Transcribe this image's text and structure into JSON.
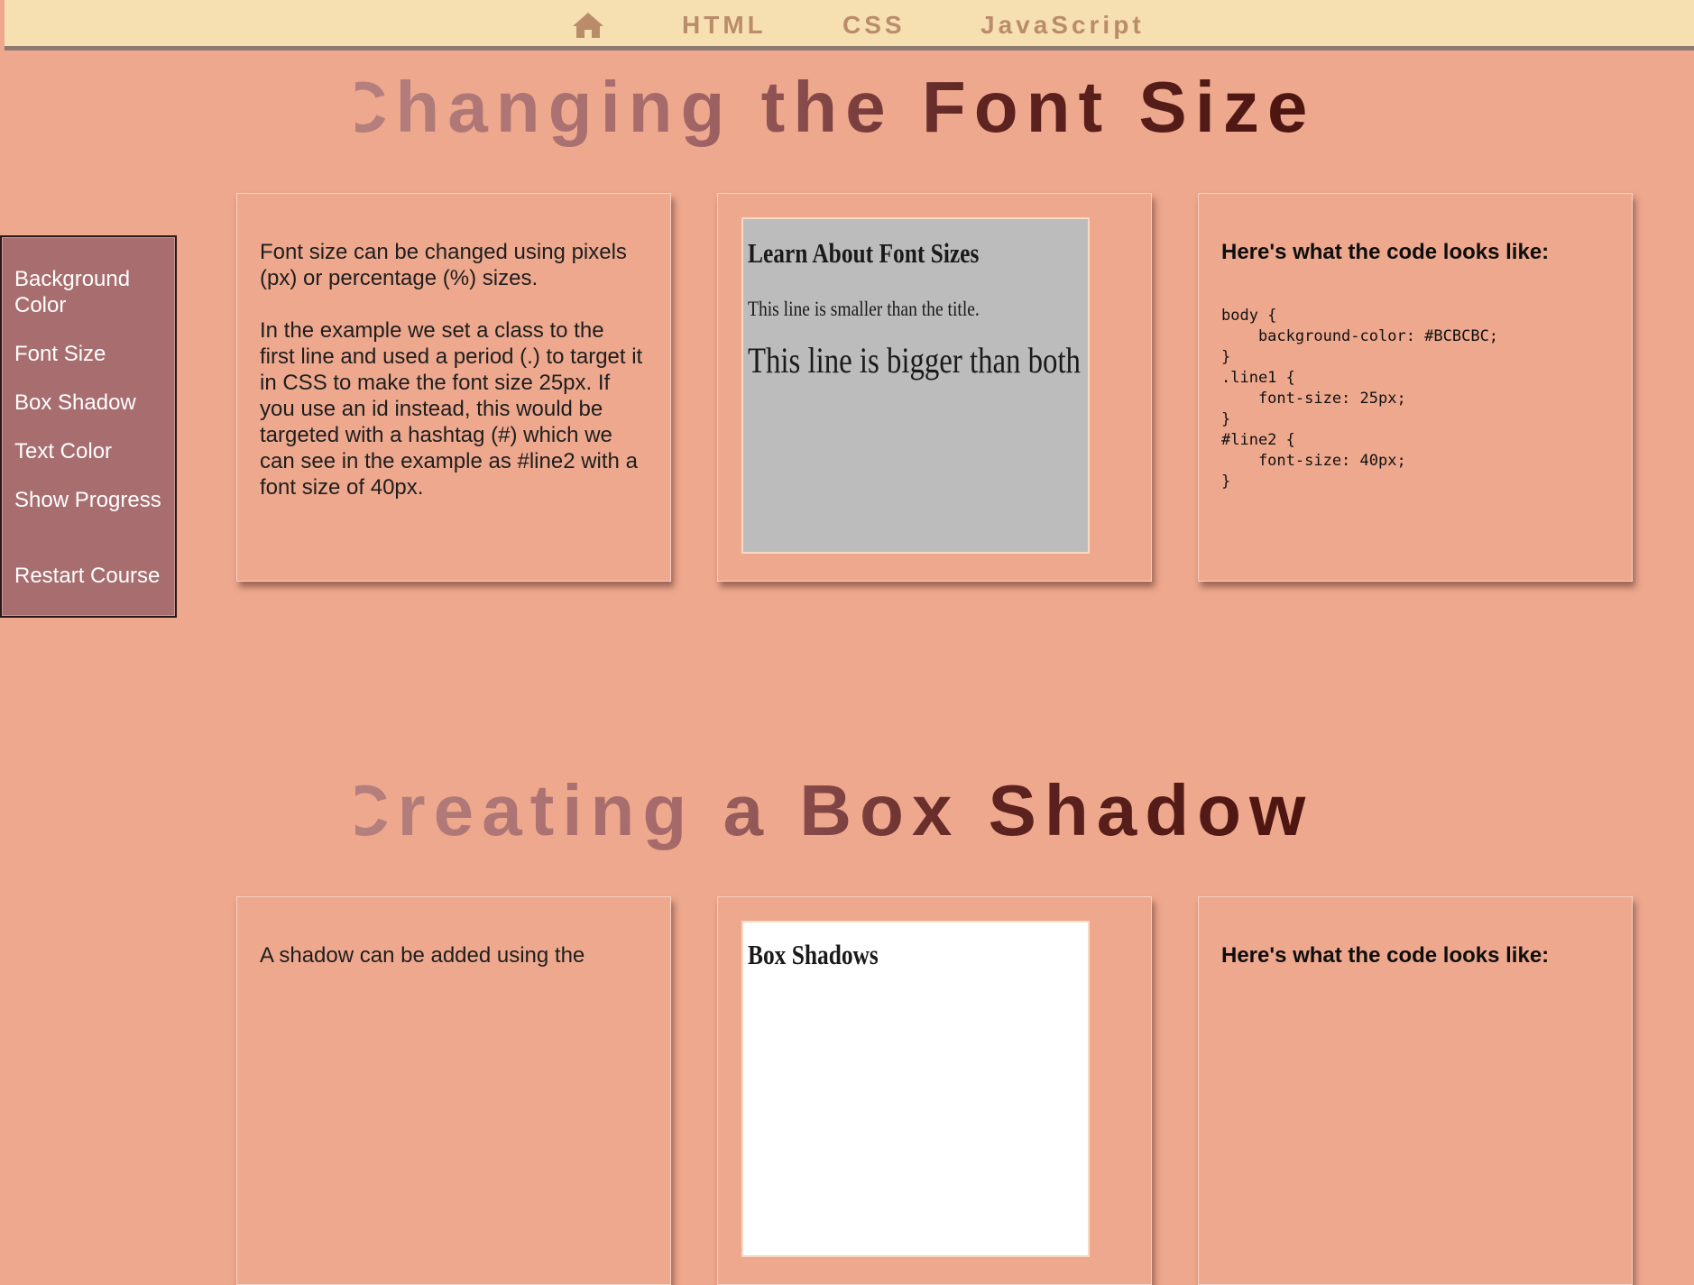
{
  "nav": {
    "home_icon": "home-icon",
    "links": [
      "HTML",
      "CSS",
      "JavaScript"
    ]
  },
  "sidebar": {
    "items": [
      {
        "label": "Background Color"
      },
      {
        "label": "Font Size"
      },
      {
        "label": "Box Shadow"
      },
      {
        "label": "Text Color"
      },
      {
        "label": "Show Progress"
      },
      {
        "label": "Restart Course"
      }
    ]
  },
  "sections": [
    {
      "title": "Changing the Font Size",
      "explanation": [
        "Font size can be changed using pixels (px) or percentage (%) sizes.",
        "In the example we set a class to the first line and used a period (.) to target it in CSS to make the font size 25px. If you use an id instead, this would be targeted with a hashtag (#) which we can see in the example as #line2 with a font size of 40px."
      ],
      "example": {
        "title": "Learn About Font Sizes",
        "line1": "This line is smaller than the title.",
        "line2": "This line is bigger than both"
      },
      "code_heading": "Here's what the code looks like:",
      "code_lines": [
        "body {",
        "    background-color: #BCBCBC;",
        "}",
        ".line1 {",
        "    font-size: 25px;",
        "}",
        "#line2 {",
        "    font-size: 40px;",
        "}"
      ]
    },
    {
      "title": "Creating a Box Shadow",
      "explanation": [
        "A shadow can be added using the"
      ],
      "example": {
        "title": "Box Shadows"
      },
      "code_heading": "Here's what the code looks like:"
    }
  ],
  "colors": {
    "page_background": "#EEA88E",
    "nav_background": "#F6E0B2",
    "nav_text": "#BA8C69",
    "sidebar_background": "#A86D6F",
    "example_background": "#BCBCBC"
  }
}
